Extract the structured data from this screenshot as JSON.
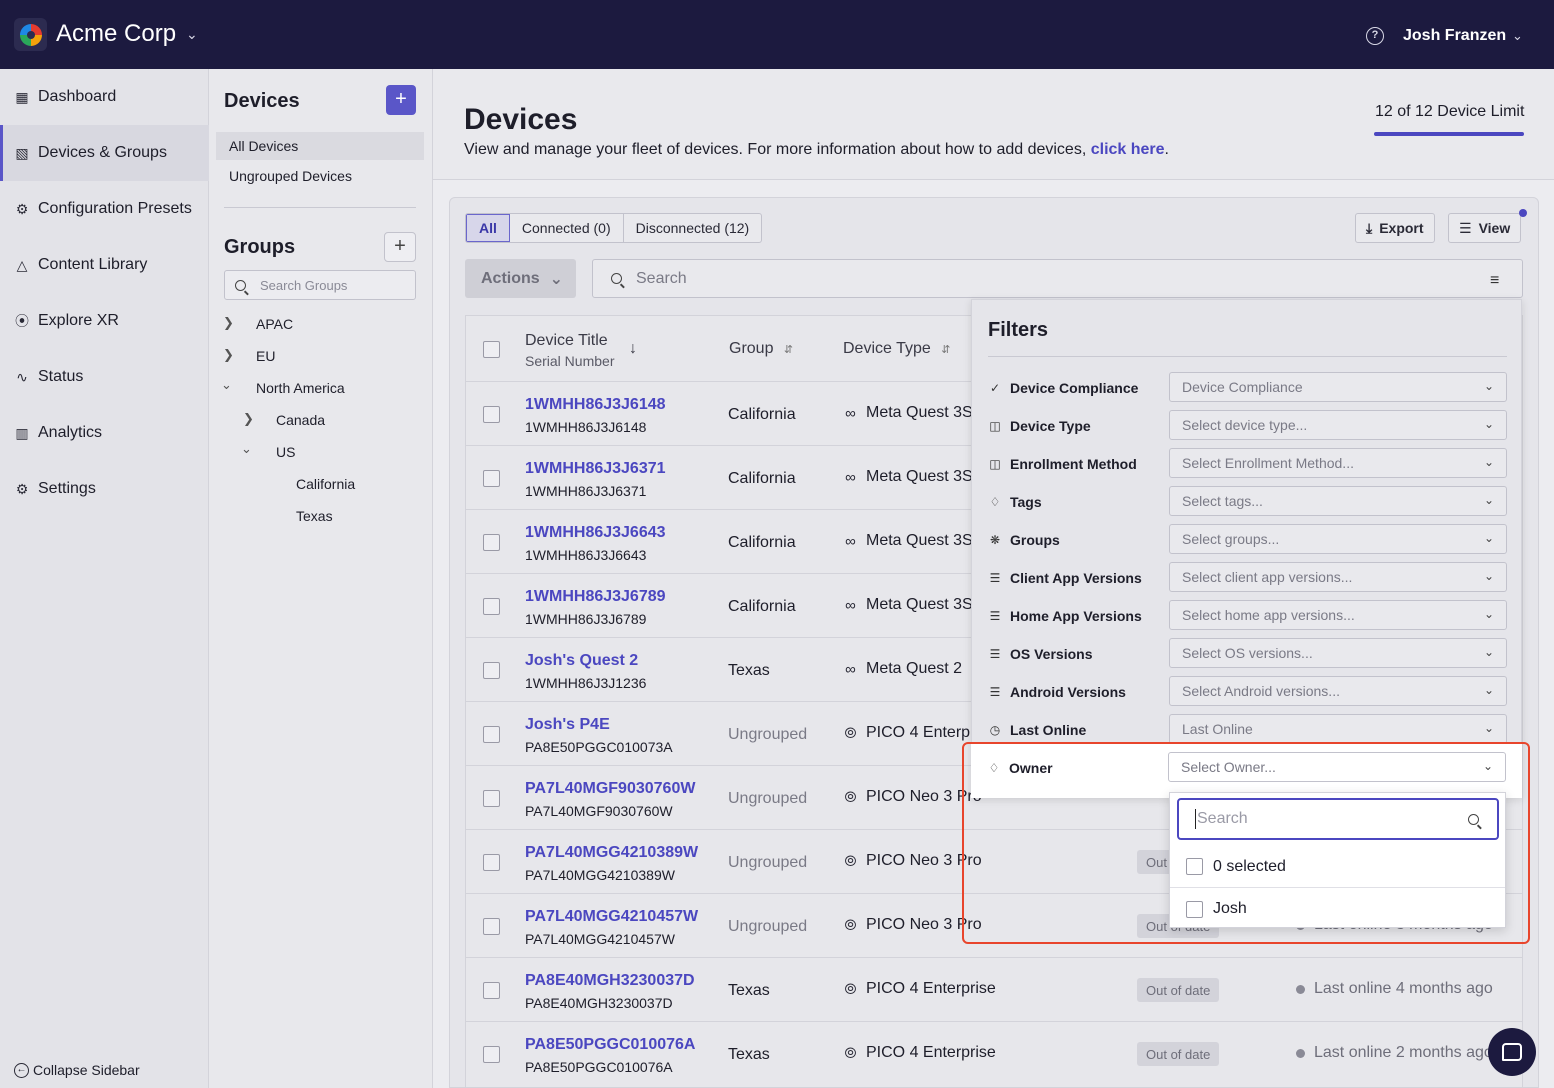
{
  "topbar": {
    "org_name": "Acme Corp",
    "user_name": "Josh Franzen",
    "help_glyph": "?"
  },
  "sidebar": {
    "items": [
      {
        "label": "Dashboard",
        "icon": "dashboard-icon"
      },
      {
        "label": "Devices & Groups",
        "icon": "devices-icon",
        "active": true
      },
      {
        "label": "Configuration Presets",
        "icon": "gear-icon"
      },
      {
        "label": "Content Library",
        "icon": "shapes-icon"
      },
      {
        "label": "Explore XR",
        "icon": "compass-icon"
      },
      {
        "label": "Status",
        "icon": "pulse-icon"
      },
      {
        "label": "Analytics",
        "icon": "bar-chart-icon"
      },
      {
        "label": "Settings",
        "icon": "gear-icon"
      }
    ],
    "collapse_label": "Collapse Sidebar"
  },
  "devices_panel": {
    "title": "Devices",
    "items": [
      "All Devices",
      "Ungrouped Devices"
    ],
    "groups_title": "Groups",
    "groups_search_placeholder": "Search Groups",
    "tree": [
      "APAC",
      "EU",
      "North America",
      "Canada",
      "US",
      "California",
      "Texas"
    ]
  },
  "header": {
    "title": "Devices",
    "description": "View and manage your fleet of devices. For more information about how to add devices, ",
    "link_text": "click here",
    "period": ".",
    "device_limit": "12 of 12 Device Limit"
  },
  "toolbar": {
    "tabs": [
      "All",
      "Connected (0)",
      "Disconnected (12)"
    ],
    "export_label": "Export",
    "view_label": "View",
    "actions_label": "Actions",
    "search_placeholder": "Search"
  },
  "table": {
    "headers": {
      "title": "Device Title",
      "serial": "Serial Number",
      "group": "Group",
      "type": "Device Type"
    },
    "rows": [
      {
        "title": "1WMHH86J3J6148",
        "serial": "1WMHH86J3J6148",
        "group": "California",
        "type": "Meta Quest 3S",
        "brand": "meta"
      },
      {
        "title": "1WMHH86J3J6371",
        "serial": "1WMHH86J3J6371",
        "group": "California",
        "type": "Meta Quest 3S",
        "brand": "meta"
      },
      {
        "title": "1WMHH86J3J6643",
        "serial": "1WMHH86J3J6643",
        "group": "California",
        "type": "Meta Quest 3S",
        "brand": "meta"
      },
      {
        "title": "1WMHH86J3J6789",
        "serial": "1WMHH86J3J6789",
        "group": "California",
        "type": "Meta Quest 3S",
        "brand": "meta"
      },
      {
        "title": "Josh's Quest 2",
        "serial": "1WMHH86J3J1236",
        "group": "Texas",
        "type": "Meta Quest 2",
        "brand": "meta"
      },
      {
        "title": "Josh's P4E",
        "serial": "PA8E50PGGC010073A",
        "group": "Ungrouped",
        "type": "PICO 4 Enterprise",
        "brand": "pico"
      },
      {
        "title": "PA7L40MGF9030760W",
        "serial": "PA7L40MGF9030760W",
        "group": "Ungrouped",
        "type": "PICO Neo 3 Pro",
        "brand": "pico"
      },
      {
        "title": "PA7L40MGG4210389W",
        "serial": "PA7L40MGG4210389W",
        "group": "Ungrouped",
        "type": "PICO Neo 3 Pro",
        "brand": "pico"
      },
      {
        "title": "PA7L40MGG4210457W",
        "serial": "PA7L40MGG4210457W",
        "group": "Ungrouped",
        "type": "PICO Neo 3 Pro",
        "brand": "pico"
      },
      {
        "title": "PA8E40MGH3230037D",
        "serial": "PA8E40MGH3230037D",
        "group": "Texas",
        "type": "PICO 4 Enterprise",
        "brand": "pico",
        "status": "Out of date",
        "last_online": "Last online 4 months ago"
      },
      {
        "title": "PA8E50PGGC010076A",
        "serial": "PA8E50PGGC010076A",
        "group": "Texas",
        "type": "PICO 4 Enterprise",
        "brand": "pico",
        "status": "Out of date",
        "last_online": "Last online 2 months ago"
      }
    ]
  },
  "filters": {
    "title": "Filters",
    "rows": [
      {
        "label": "Device Compliance",
        "placeholder": "Device Compliance",
        "icon": "check-icon"
      },
      {
        "label": "Device Type",
        "placeholder": "Select device type...",
        "icon": "headset-icon"
      },
      {
        "label": "Enrollment Method",
        "placeholder": "Select Enrollment Method...",
        "icon": "headset-icon"
      },
      {
        "label": "Tags",
        "placeholder": "Select tags...",
        "icon": "tag-icon"
      },
      {
        "label": "Groups",
        "placeholder": "Select groups...",
        "icon": "groups-icon"
      },
      {
        "label": "Client App Versions",
        "placeholder": "Select client app versions...",
        "icon": "layers-icon"
      },
      {
        "label": "Home App Versions",
        "placeholder": "Select home app versions...",
        "icon": "layers-icon"
      },
      {
        "label": "OS Versions",
        "placeholder": "Select OS versions...",
        "icon": "layers-icon"
      },
      {
        "label": "Android Versions",
        "placeholder": "Select Android versions...",
        "icon": "layers-icon"
      },
      {
        "label": "Last Online",
        "placeholder": "Last Online",
        "icon": "clock-icon"
      }
    ],
    "owner": {
      "label": "Owner",
      "placeholder": "Select Owner...",
      "search_placeholder": "Search",
      "select_all_label": "0 selected",
      "options": [
        "Josh"
      ]
    }
  },
  "obscured_rows": {
    "row9_status": "Out of date",
    "row9_last": "Last online 3 months ago"
  },
  "colors": {
    "accent": "#4b47c0",
    "topbar": "#1c1a3f",
    "highlight": "#e8452c"
  }
}
